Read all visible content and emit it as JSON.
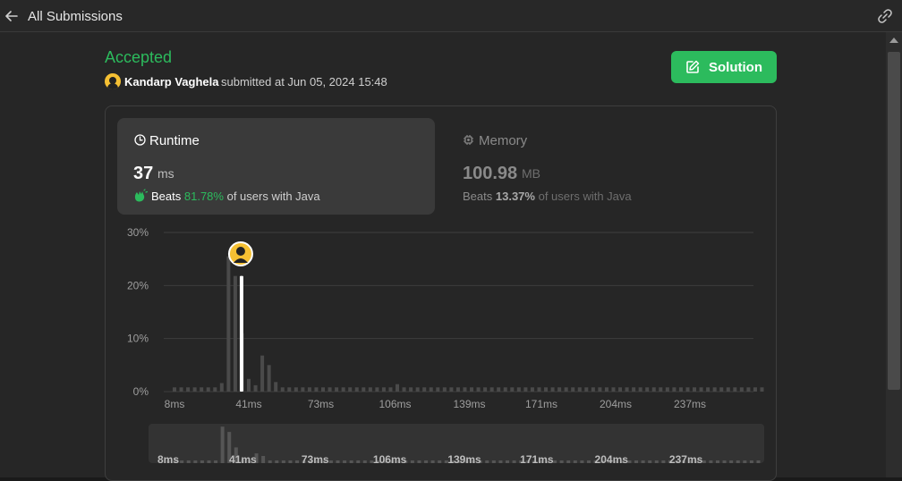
{
  "topbar": {
    "back_label": "All Submissions",
    "back_icon": "arrow-left-icon",
    "link_icon": "link-icon"
  },
  "submission": {
    "status": "Accepted",
    "submitter": "Kandarp Vaghela",
    "submitted_at": "submitted at Jun 05, 2024 15:48",
    "solution_label": "Solution",
    "status_color": "#2cbb5d",
    "accent": "#2cbb5d"
  },
  "runtime": {
    "title": "Runtime",
    "value": "37",
    "unit": "ms",
    "beats_prefix": "Beats",
    "beats_pct": "81.78%",
    "beats_suffix": "of users with Java"
  },
  "memory": {
    "title": "Memory",
    "value": "100.98",
    "unit": "MB",
    "beats_prefix": "Beats",
    "beats_pct": "13.37%",
    "beats_suffix": "of users with Java"
  },
  "chart_data": {
    "type": "bar",
    "y_ticks": [
      "30%",
      "20%",
      "10%",
      "0%"
    ],
    "y_tick_values": [
      30,
      20,
      10,
      0
    ],
    "ylim": [
      0,
      30
    ],
    "x_tick_labels": [
      "8ms",
      "41ms",
      "73ms",
      "106ms",
      "139ms",
      "171ms",
      "204ms",
      "237ms"
    ],
    "x_tick_values": [
      8,
      41,
      73,
      106,
      139,
      171,
      204,
      237
    ],
    "xlim": [
      8,
      270
    ],
    "bin_width": 3,
    "grid": true,
    "series": [
      {
        "x": [
          8,
          11,
          14,
          17,
          20,
          23,
          26,
          29,
          32,
          35,
          38,
          41,
          44,
          47,
          50,
          53,
          56,
          59,
          62,
          65,
          68,
          71,
          74,
          77,
          80,
          83,
          86,
          89,
          92,
          95,
          98,
          101,
          104,
          107,
          110,
          113,
          116,
          119,
          122,
          125,
          128,
          131,
          134,
          137,
          140,
          143,
          146,
          149,
          152,
          155,
          158,
          161,
          164,
          167,
          170,
          173,
          176,
          179,
          182,
          185,
          188,
          191,
          194,
          197,
          200,
          203,
          206,
          209,
          212,
          215,
          218,
          221,
          224,
          227,
          230,
          233,
          236,
          239,
          242,
          245,
          248,
          251,
          254,
          257,
          260,
          263,
          266,
          269
        ],
        "values": [
          0.8,
          0.8,
          0.8,
          0.8,
          0.8,
          0.8,
          0.8,
          1.6,
          25.5,
          21.8,
          11.0,
          2.4,
          1.2,
          6.8,
          5.0,
          1.8,
          0.8,
          0.8,
          0.8,
          0.8,
          0.8,
          0.8,
          0.8,
          0.8,
          0.8,
          0.8,
          0.8,
          0.8,
          0.8,
          0.8,
          0.8,
          0.8,
          0.8,
          1.4,
          0.8,
          0.8,
          0.8,
          0.8,
          0.8,
          0.8,
          0.8,
          0.8,
          0.8,
          0.8,
          0.8,
          0.8,
          0.8,
          0.8,
          0.8,
          0.8,
          0.8,
          0.8,
          0.8,
          0.8,
          0.8,
          0.8,
          0.8,
          0.8,
          0.8,
          0.8,
          0.8,
          0.8,
          0.8,
          0.8,
          0.8,
          0.8,
          0.8,
          0.8,
          0.8,
          0.8,
          0.8,
          0.8,
          0.8,
          0.8,
          0.8,
          0.8,
          0.8,
          0.8,
          0.8,
          0.8,
          0.8,
          0.8,
          0.8,
          0.8,
          0.8,
          0.8,
          0.8,
          0.8
        ]
      }
    ],
    "highlight_x": 37,
    "bar_color": "#4a4a4a",
    "highlight_color": "#ffffff",
    "overview": {
      "x_tick_labels": [
        "8ms",
        "41ms",
        "73ms",
        "106ms",
        "139ms",
        "171ms",
        "204ms",
        "237ms"
      ]
    }
  }
}
